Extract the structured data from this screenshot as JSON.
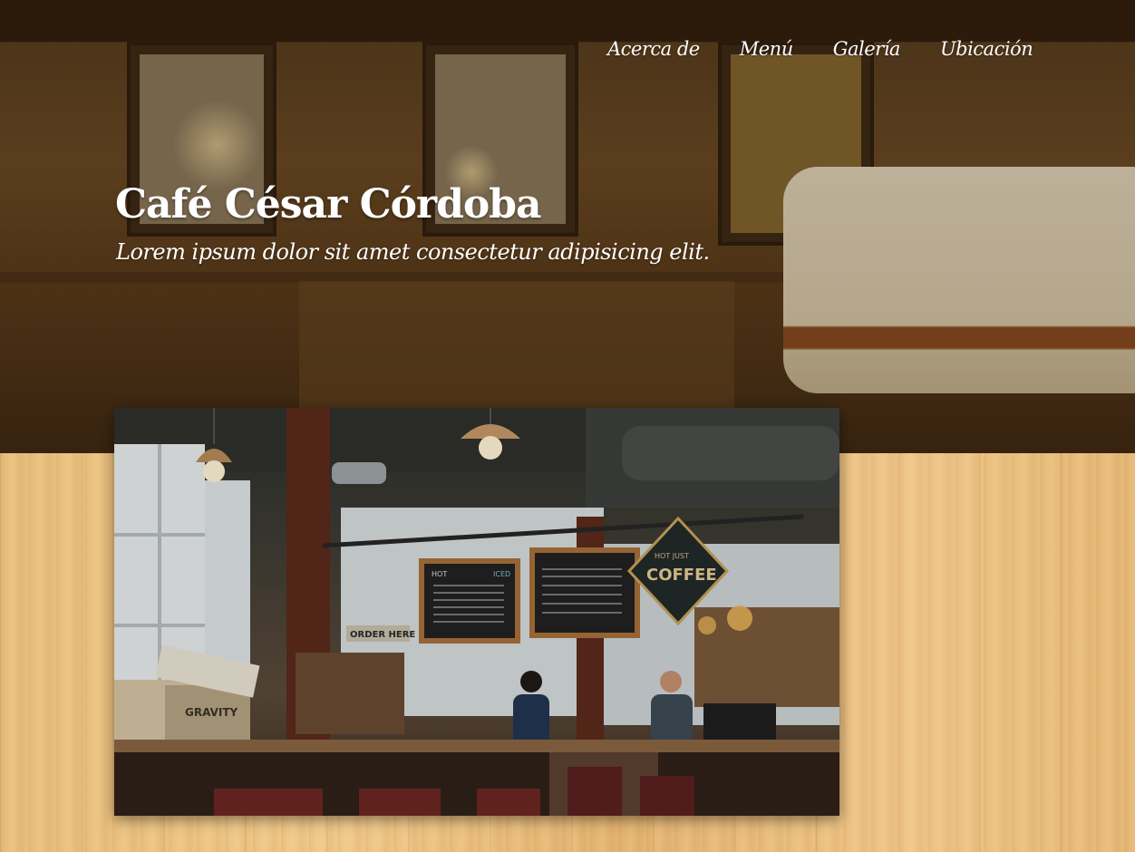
{
  "nav": {
    "items": [
      {
        "label": "Acerca de"
      },
      {
        "label": "Menú"
      },
      {
        "label": "Galería"
      },
      {
        "label": "Ubicación"
      }
    ]
  },
  "hero": {
    "title": "Café César Córdoba",
    "tagline": "Lorem ipsum dolor sit amet consectetur adipisicing elit."
  },
  "photo": {
    "sign_coffee": "COFFEE",
    "sign_hot": "HOT JUST",
    "sign_order": "ORDER HERE",
    "crate_brand": "GRAVITY",
    "menu_hot": "HOT",
    "menu_iced": "ICED"
  },
  "colors": {
    "text": "#ffffff",
    "wood": "#e8be7d",
    "hero_dark": "#2c1b0b"
  }
}
